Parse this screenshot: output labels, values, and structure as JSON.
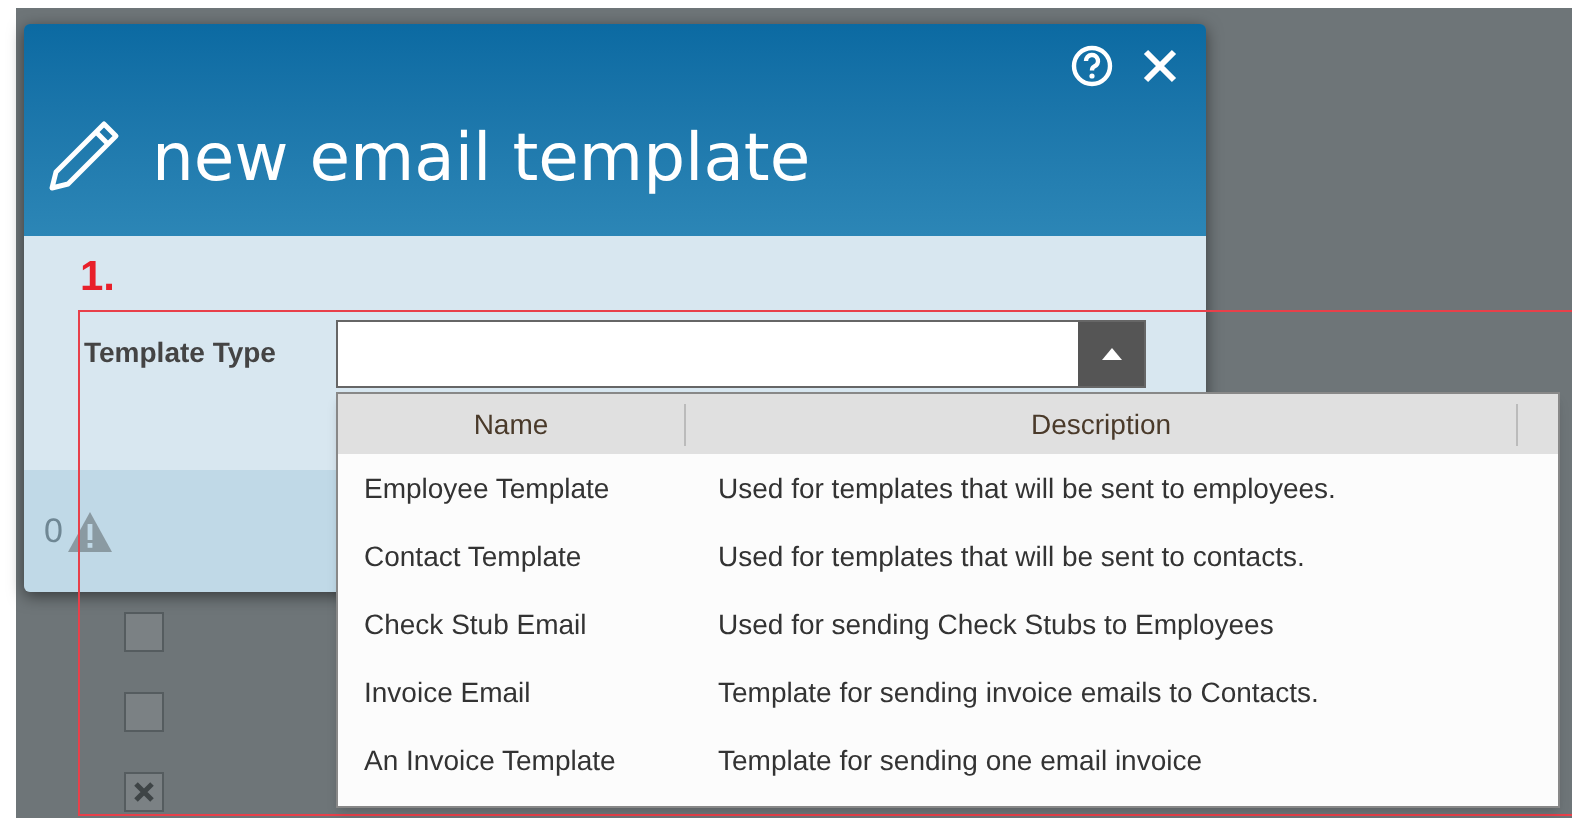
{
  "dialog": {
    "title": "new email template",
    "annotation": "1.",
    "field": {
      "label": "Template Type",
      "expanded": true
    },
    "footer": {
      "count": "0"
    }
  },
  "background_checkboxes": [
    {
      "checked": false
    },
    {
      "checked": false
    },
    {
      "checked": true
    }
  ],
  "dropdown": {
    "columns": [
      "Name",
      "Description"
    ],
    "rows": [
      {
        "name": "Employee Template",
        "description": "Used for templates that will be sent to employees."
      },
      {
        "name": "Contact Template",
        "description": "Used for templates that will be sent to contacts."
      },
      {
        "name": "Check Stub Email",
        "description": "Used for sending Check Stubs to Employees"
      },
      {
        "name": "Invoice Email",
        "description": "Template for sending invoice emails to Contacts."
      },
      {
        "name": "An Invoice Template",
        "description": "Template for sending one email invoice"
      }
    ]
  }
}
